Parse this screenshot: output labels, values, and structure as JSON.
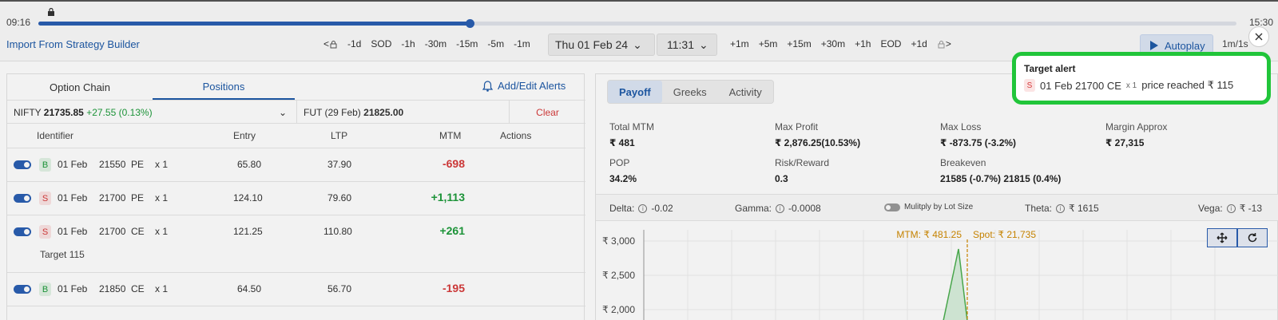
{
  "timeline": {
    "start_time": "09:16",
    "end_time": "15:30",
    "progress": 0.36
  },
  "toolbar": {
    "import_label": "Import From Strategy Builder",
    "back_steps": [
      "-1d",
      "SOD",
      "-1h",
      "-30m",
      "-15m",
      "-5m",
      "-1m"
    ],
    "date_label": "Thu  01 Feb 24",
    "time_label": "11:31",
    "fwd_steps": [
      "+1m",
      "+5m",
      "+15m",
      "+30m",
      "+1h",
      "EOD",
      "+1d"
    ],
    "autoplay_label": "Autoplay",
    "speed_label": "1m/1s"
  },
  "left": {
    "tab_option_chain": "Option Chain",
    "tab_positions": "Positions",
    "alerts_label": "Add/Edit Alerts",
    "nifty_label": "NIFTY",
    "nifty_price": "21735.85",
    "nifty_change": "+27.55 (0.13%)",
    "fut_label": "FUT (29 Feb)",
    "fut_price": "21825.00",
    "clear_label": "Clear",
    "headers": {
      "identifier": "Identifier",
      "entry": "Entry",
      "ltp": "LTP",
      "mtm": "MTM",
      "actions": "Actions"
    },
    "rows": [
      {
        "side": "B",
        "date": "01 Feb",
        "strike": "21550",
        "type": "PE",
        "qty": "x 1",
        "entry": "65.80",
        "ltp": "37.90",
        "mtm": "-698",
        "note": ""
      },
      {
        "side": "S",
        "date": "01 Feb",
        "strike": "21700",
        "type": "PE",
        "qty": "x 1",
        "entry": "124.10",
        "ltp": "79.60",
        "mtm": "+1,113",
        "note": ""
      },
      {
        "side": "S",
        "date": "01 Feb",
        "strike": "21700",
        "type": "CE",
        "qty": "x 1",
        "entry": "121.25",
        "ltp": "110.80",
        "mtm": "+261",
        "note_label": "Target",
        "note_value": "115"
      },
      {
        "side": "B",
        "date": "01 Feb",
        "strike": "21850",
        "type": "CE",
        "qty": "x 1",
        "entry": "64.50",
        "ltp": "56.70",
        "mtm": "-195",
        "note": ""
      }
    ]
  },
  "right": {
    "tabs": [
      "Payoff",
      "Greeks",
      "Activity"
    ],
    "stats": {
      "total_mtm_label": "Total MTM",
      "total_mtm": "₹ 481",
      "max_profit_label": "Max Profit",
      "max_profit": "₹ 2,876.25(10.53%)",
      "max_loss_label": "Max Loss",
      "max_loss": "₹ -873.75 (-3.2%)",
      "margin_label": "Margin Approx",
      "margin": "₹ 27,315",
      "pop_label": "POP",
      "pop": "34.2%",
      "rr_label": "Risk/Reward",
      "rr": "0.3",
      "be_label": "Breakeven",
      "be": "21585 (-0.7%)  21815 (0.4%)"
    },
    "greeks": {
      "delta_label": "Delta:",
      "delta": "-0.02",
      "gamma_label": "Gamma:",
      "gamma": "-0.0008",
      "multiply_label": "Mulitply by Lot Size",
      "theta_label": "Theta:",
      "theta": "₹ 1615",
      "vega_label": "Vega:",
      "vega": "₹ -13"
    },
    "chart": {
      "mtm_label": "MTM: ₹ 481.25",
      "spot_label": "Spot: ₹ 21,735",
      "y_ticks": [
        "₹ 3,000",
        "₹ 2,500",
        "₹ 2,000"
      ]
    }
  },
  "toast": {
    "title": "Target alert",
    "side": "S",
    "instrument": "01 Feb 21700 CE",
    "qty": "x 1",
    "message": "price reached ₹ 115",
    "border_color": "#21c53a"
  },
  "colors": {
    "accent": "#1e5aa8",
    "profit": "#1e9b3c",
    "loss": "#d63b3b"
  }
}
